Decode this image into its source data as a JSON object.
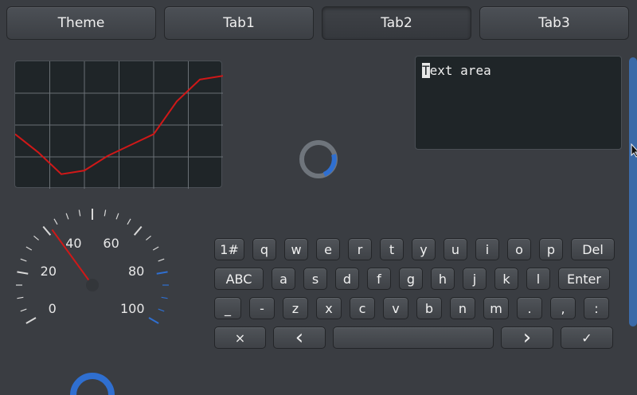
{
  "tabs": [
    {
      "label": "Theme",
      "active": false
    },
    {
      "label": "Tab1",
      "active": false
    },
    {
      "label": "Tab2",
      "active": true
    },
    {
      "label": "Tab3",
      "active": false
    }
  ],
  "textarea": {
    "caret_char": "T",
    "rest": "ext area"
  },
  "gauge": {
    "labels": [
      "0",
      "20",
      "40",
      "60",
      "80",
      "100"
    ],
    "needle_value": 35,
    "range": [
      0,
      100
    ],
    "accent_color": "#2f6fd0",
    "needle_color": "#d01818"
  },
  "spinner": {
    "accent_color": "#2f6fd0"
  },
  "keyboard": {
    "row1": [
      "1#",
      "q",
      "w",
      "e",
      "r",
      "t",
      "y",
      "u",
      "i",
      "o",
      "p",
      "Del"
    ],
    "row2": [
      "ABC",
      "a",
      "s",
      "d",
      "f",
      "g",
      "h",
      "j",
      "k",
      "l",
      "Enter"
    ],
    "row3": [
      "_",
      "-",
      "z",
      "x",
      "c",
      "v",
      "b",
      "n",
      "m",
      ".",
      ",",
      ":"
    ],
    "row4": [
      "×",
      "‹",
      "",
      "›",
      "✓"
    ]
  },
  "chart_data": {
    "type": "line",
    "x": [
      0,
      1,
      2,
      3,
      4,
      5,
      6,
      7,
      8,
      9
    ],
    "values": [
      1.5,
      1.0,
      0.4,
      0.5,
      0.9,
      1.2,
      1.5,
      2.4,
      3.0,
      3.1
    ],
    "ylim": [
      0,
      3.5
    ],
    "grid": true,
    "line_color": "#d01818"
  }
}
